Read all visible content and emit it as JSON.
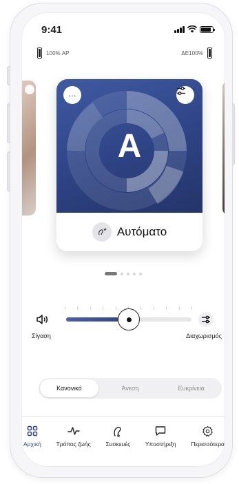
{
  "status_bar": {
    "time": "9:41"
  },
  "hearing_aids": {
    "left": {
      "label": "100% AP",
      "level": 1.0
    },
    "right": {
      "label": "ΔE100%",
      "level": 1.0
    }
  },
  "program": {
    "letter": "A",
    "name": "Αυτόματο",
    "more_icon": "more-icon",
    "settings_icon": "sliders-icon"
  },
  "carousel": {
    "pages": 5,
    "current": 1
  },
  "volume": {
    "mute_label": "Σίγαση",
    "split_label": "Διαχωρισμός",
    "level": 0.5
  },
  "segments": {
    "options": [
      "Κανονικό",
      "Άνεση",
      "Ευκρίνεια"
    ],
    "selected": 0
  },
  "nav": {
    "items": [
      {
        "label": "Αρχική",
        "icon": "grid-icon"
      },
      {
        "label": "Τρόπος ζωής",
        "icon": "activity-icon"
      },
      {
        "label": "Συσκευές",
        "icon": "hearing-aid-icon"
      },
      {
        "label": "Υποστήριξη",
        "icon": "chat-icon"
      },
      {
        "label": "Περισσότερα",
        "icon": "gear-icon"
      }
    ],
    "active": 0
  },
  "colors": {
    "accent": "#2e4384",
    "card_bg": "#3f5aa2"
  }
}
